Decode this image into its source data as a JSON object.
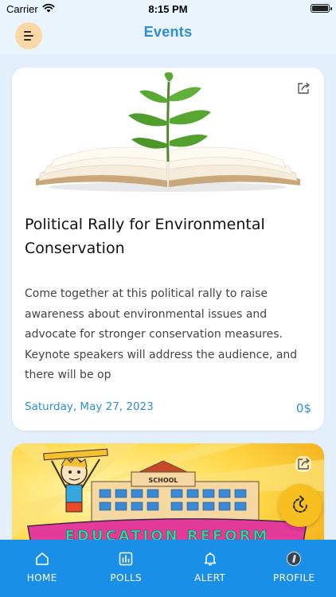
{
  "status_bar": {
    "carrier": "Carrier",
    "time": "8:15 PM"
  },
  "header": {
    "title": "Events"
  },
  "events": [
    {
      "title": "Political Rally for Environmental Conservation",
      "description": "Come together at this political rally to raise awareness about environmental issues and advocate for stronger conservation measures. Keynote speakers will address the audience, and there will be op",
      "date": "Saturday, May 27, 2023",
      "price": "0$",
      "image": "book-with-plant"
    },
    {
      "image": "education-reform-cartoon",
      "image_text": {
        "school_sign": "SCHOOL",
        "banner": "EDUCATION REFORM"
      }
    }
  ],
  "bottom_nav": [
    {
      "label": "HOME",
      "icon": "home-icon"
    },
    {
      "label": "POLLS",
      "icon": "polls-icon"
    },
    {
      "label": "ALERT",
      "icon": "bell-icon"
    },
    {
      "label": "PROFILE",
      "icon": "avatar"
    }
  ],
  "colors": {
    "accent": "#2d8ed6",
    "nav_bar": "#1a8fe8",
    "background": "#e3f0fc",
    "fab": "#f7bf1f",
    "menu_button": "#fbd9a6"
  }
}
